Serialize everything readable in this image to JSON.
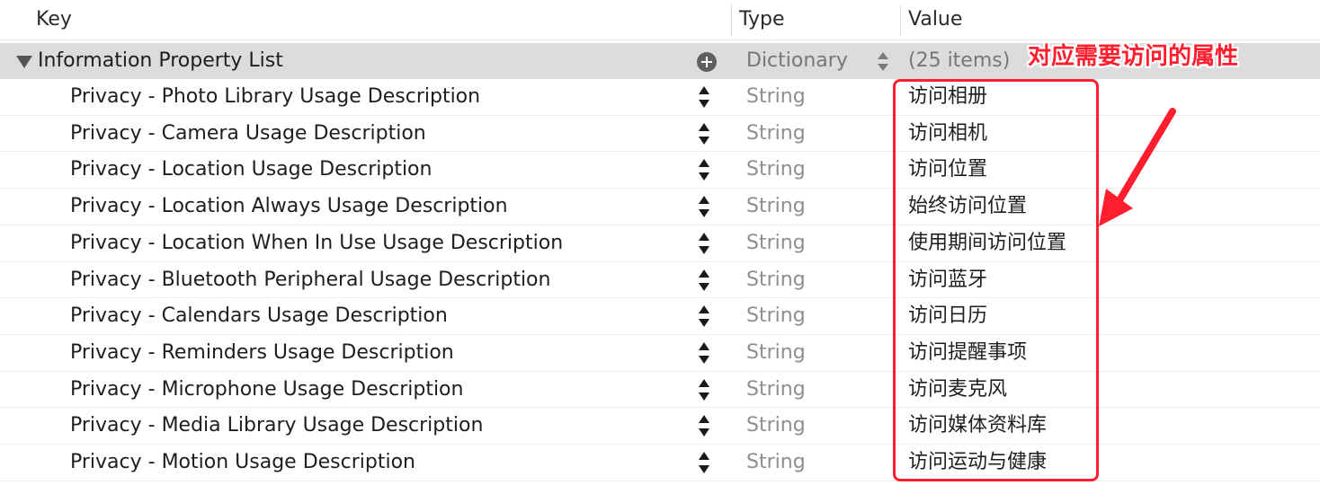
{
  "header": {
    "key_label": "Key",
    "type_label": "Type",
    "value_label": "Value"
  },
  "root": {
    "key": "Information Property List",
    "type": "Dictionary",
    "value": "(25 items)"
  },
  "rows": [
    {
      "key": "Privacy - Photo Library Usage Description",
      "type": "String",
      "value": "访问相册"
    },
    {
      "key": "Privacy - Camera Usage Description",
      "type": "String",
      "value": "访问相机"
    },
    {
      "key": "Privacy - Location Usage Description",
      "type": "String",
      "value": "访问位置"
    },
    {
      "key": "Privacy - Location Always Usage Description",
      "type": "String",
      "value": "始终访问位置"
    },
    {
      "key": "Privacy - Location When In Use Usage Description",
      "type": "String",
      "value": "使用期间访问位置"
    },
    {
      "key": "Privacy - Bluetooth Peripheral Usage Description",
      "type": "String",
      "value": "访问蓝牙"
    },
    {
      "key": "Privacy - Calendars Usage Description",
      "type": "String",
      "value": "访问日历"
    },
    {
      "key": "Privacy - Reminders Usage Description",
      "type": "String",
      "value": "访问提醒事项"
    },
    {
      "key": "Privacy - Microphone Usage Description",
      "type": "String",
      "value": "访问麦克风"
    },
    {
      "key": "Privacy - Media Library Usage Description",
      "type": "String",
      "value": "访问媒体资料库"
    },
    {
      "key": "Privacy - Motion Usage Description",
      "type": "String",
      "value": "访问运动与健康"
    }
  ],
  "annotation": {
    "text": "对应需要访问的属性",
    "color": "#ff1e2e"
  },
  "icons": {
    "disclosure": "disclosure-triangle-icon",
    "add": "add-circle-icon",
    "stepper": "stepper-icon"
  }
}
